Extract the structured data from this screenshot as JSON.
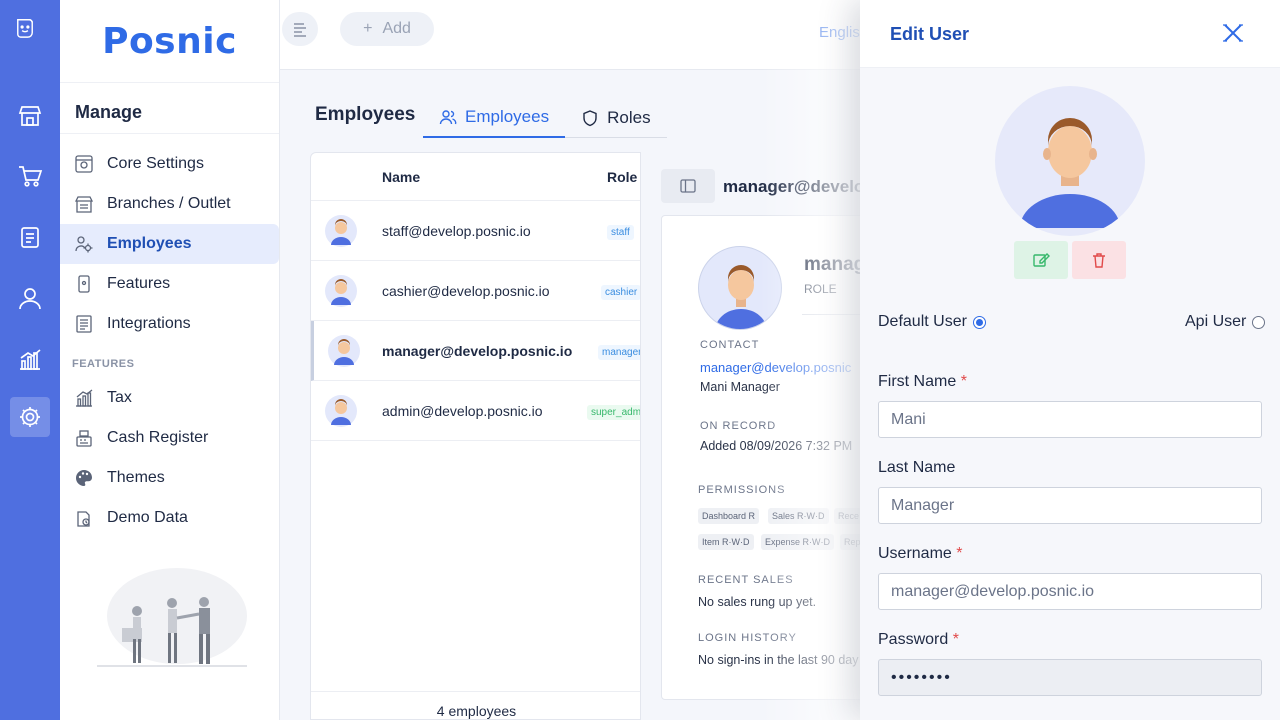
{
  "app": {
    "brand": "Posnic"
  },
  "topbar": {
    "add_label": "Add",
    "language": "English"
  },
  "sidebar": {
    "heading": "Manage",
    "items": [
      {
        "label": "Core Settings",
        "icon": "settings-panel-icon"
      },
      {
        "label": "Branches / Outlet",
        "icon": "store-icon"
      },
      {
        "label": "Employees",
        "icon": "employees-gear-icon",
        "active": true
      },
      {
        "label": "Features",
        "icon": "phone-icon"
      },
      {
        "label": "Integrations",
        "icon": "list-doc-icon"
      }
    ],
    "section_label": "FEATURES",
    "feature_items": [
      {
        "label": "Tax",
        "icon": "chart-icon"
      },
      {
        "label": "Cash Register",
        "icon": "register-icon"
      },
      {
        "label": "Themes",
        "icon": "palette-icon"
      },
      {
        "label": "Demo Data",
        "icon": "demo-icon"
      }
    ]
  },
  "main": {
    "title": "Employees",
    "tabs": [
      {
        "label": "Employees",
        "active": true
      },
      {
        "label": "Roles",
        "active": false
      }
    ],
    "table": {
      "columns": [
        "Name",
        "Role"
      ],
      "rows": [
        {
          "name": "staff@develop.posnic.io",
          "role": "staff"
        },
        {
          "name": "cashier@develop.posnic.io",
          "role": "cashier"
        },
        {
          "name": "manager@develop.posnic.io",
          "role": "manager"
        },
        {
          "name": "admin@develop.posnic.io",
          "role": "super_adm"
        }
      ],
      "footer": "4 employees"
    }
  },
  "detail": {
    "title": "manager@develo",
    "name": "manag",
    "role_label": "ROLE",
    "contact_label": "CONTACT",
    "contact_email": "manager@develop.posnic",
    "contact_name": "Mani Manager",
    "on_record_label": "ON RECORD",
    "on_record_value": "Added 08/09/2026 7:32 PM",
    "permissions_label": "PERMISSIONS",
    "permissions": [
      "Dashboard R",
      "Sales R·W·D",
      "Rece",
      "Item R·W·D",
      "Expense R·W·D",
      "Rep"
    ],
    "recent_sales_label": "RECENT SALES",
    "recent_sales_value": "No sales rung up yet.",
    "login_history_label": "LOGIN HISTORY",
    "login_history_value": "No sign-ins in the last 90 day"
  },
  "drawer": {
    "title": "Edit User",
    "user_type": {
      "default_label": "Default User",
      "api_label": "Api User",
      "selected": "default"
    },
    "fields": {
      "first_name": {
        "label": "First Name",
        "value": "Mani",
        "required": "*"
      },
      "last_name": {
        "label": "Last Name",
        "value": "Manager"
      },
      "username": {
        "label": "Username",
        "value": "manager@develop.posnic.io",
        "required": "*"
      },
      "password": {
        "label": "Password",
        "value": "••••••••",
        "required": "*"
      }
    }
  },
  "colors": {
    "accent": "#2f6be6",
    "rail": "#4f6fe0",
    "active_bg": "#e6ecfd"
  }
}
